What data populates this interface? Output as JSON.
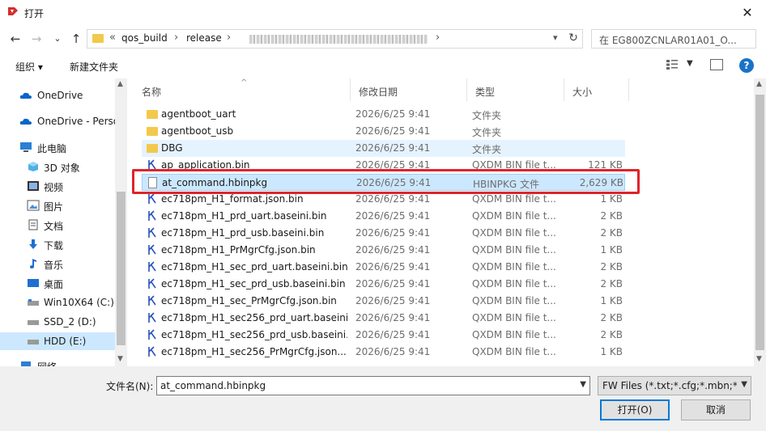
{
  "window": {
    "title": "打开",
    "close_glyph": "✕"
  },
  "nav": {
    "back_glyph": "←",
    "forward_glyph": "→",
    "recent_glyph": "⌄",
    "up_glyph": "↑",
    "path_overflow": "«",
    "path": [
      "qos_build",
      "release"
    ],
    "refresh_glyph": "↻",
    "search_placeholder": "在 EG800ZCNLAR01A01_O..."
  },
  "toolbar": {
    "organize": "组织 ▾",
    "new_folder": "新建文件夹"
  },
  "sidebar": {
    "items": [
      {
        "label": "OneDrive",
        "icon": "cloud-icon"
      },
      {
        "label": "OneDrive - Perso",
        "icon": "cloud-icon"
      },
      {
        "label": "此电脑",
        "icon": "computer-icon"
      },
      {
        "label": "3D 对象",
        "icon": "cube-icon"
      },
      {
        "label": "视频",
        "icon": "video-icon"
      },
      {
        "label": "图片",
        "icon": "picture-icon"
      },
      {
        "label": "文档",
        "icon": "document-icon"
      },
      {
        "label": "下载",
        "icon": "download-icon"
      },
      {
        "label": "音乐",
        "icon": "music-icon"
      },
      {
        "label": "桌面",
        "icon": "desktop-icon"
      },
      {
        "label": "Win10X64 (C:)",
        "icon": "drive-icon"
      },
      {
        "label": "SSD_2 (D:)",
        "icon": "drive-icon"
      },
      {
        "label": "HDD (E:)",
        "icon": "drive-icon"
      },
      {
        "label": "网络",
        "icon": "network-icon"
      }
    ]
  },
  "columns": {
    "name": "名称",
    "date": "修改日期",
    "type": "类型",
    "size": "大小"
  },
  "files": [
    {
      "name": "agentboot_uart",
      "date": "2026/6/25 9:41",
      "type": "文件夹",
      "size": "",
      "kind": "folder"
    },
    {
      "name": "agentboot_usb",
      "date": "2026/6/25 9:41",
      "type": "文件夹",
      "size": "",
      "kind": "folder"
    },
    {
      "name": "DBG",
      "date": "2026/6/25 9:41",
      "type": "文件夹",
      "size": "",
      "kind": "folder"
    },
    {
      "name": "ap_application.bin",
      "date": "2026/6/25 9:41",
      "type": "QXDM BIN file t...",
      "size": "121 KB",
      "kind": "bin"
    },
    {
      "name": "at_command.hbinpkg",
      "date": "2026/6/25 9:41",
      "type": "HBINPKG 文件",
      "size": "2,629 KB",
      "kind": "doc"
    },
    {
      "name": "ec718pm_H1_format.json.bin",
      "date": "2026/6/25 9:41",
      "type": "QXDM BIN file t...",
      "size": "1 KB",
      "kind": "bin"
    },
    {
      "name": "ec718pm_H1_prd_uart.baseini.bin",
      "date": "2026/6/25 9:41",
      "type": "QXDM BIN file t...",
      "size": "2 KB",
      "kind": "bin"
    },
    {
      "name": "ec718pm_H1_prd_usb.baseini.bin",
      "date": "2026/6/25 9:41",
      "type": "QXDM BIN file t...",
      "size": "2 KB",
      "kind": "bin"
    },
    {
      "name": "ec718pm_H1_PrMgrCfg.json.bin",
      "date": "2026/6/25 9:41",
      "type": "QXDM BIN file t...",
      "size": "1 KB",
      "kind": "bin"
    },
    {
      "name": "ec718pm_H1_sec_prd_uart.baseini.bin",
      "date": "2026/6/25 9:41",
      "type": "QXDM BIN file t...",
      "size": "2 KB",
      "kind": "bin"
    },
    {
      "name": "ec718pm_H1_sec_prd_usb.baseini.bin",
      "date": "2026/6/25 9:41",
      "type": "QXDM BIN file t...",
      "size": "2 KB",
      "kind": "bin"
    },
    {
      "name": "ec718pm_H1_sec_PrMgrCfg.json.bin",
      "date": "2026/6/25 9:41",
      "type": "QXDM BIN file t...",
      "size": "1 KB",
      "kind": "bin"
    },
    {
      "name": "ec718pm_H1_sec256_prd_uart.baseini...",
      "date": "2026/6/25 9:41",
      "type": "QXDM BIN file t...",
      "size": "2 KB",
      "kind": "bin"
    },
    {
      "name": "ec718pm_H1_sec256_prd_usb.baseini...",
      "date": "2026/6/25 9:41",
      "type": "QXDM BIN file t...",
      "size": "2 KB",
      "kind": "bin"
    },
    {
      "name": "ec718pm_H1_sec256_PrMgrCfg.json....",
      "date": "2026/6/25 9:41",
      "type": "QXDM BIN file t...",
      "size": "1 KB",
      "kind": "bin"
    }
  ],
  "bottom": {
    "filename_label": "文件名(N):",
    "filename_value": "at_command.hbinpkg",
    "filter_value": "FW Files (*.txt;*.cfg;*.mbn;*.lo",
    "open_label": "打开(O)",
    "cancel_label": "取消"
  },
  "colors": {
    "selected": "#cce8ff",
    "highlight": "#e0232a",
    "accent": "#0078d7"
  }
}
